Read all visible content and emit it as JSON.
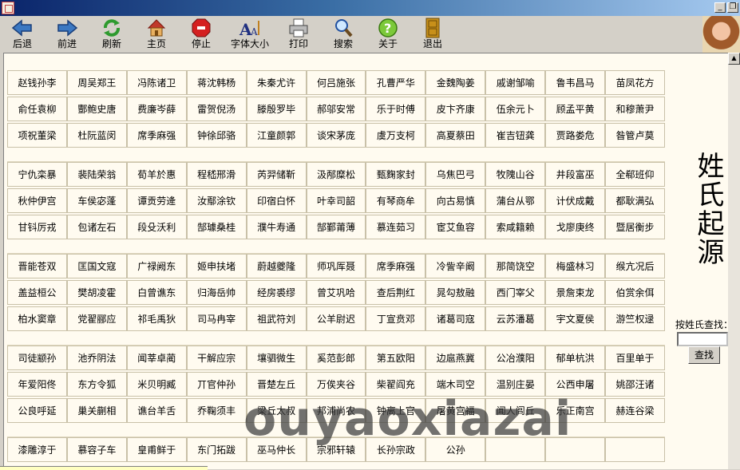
{
  "toolbar": [
    {
      "label": "后退",
      "icon": "back-arrow-icon"
    },
    {
      "label": "前进",
      "icon": "forward-arrow-icon"
    },
    {
      "label": "刷新",
      "icon": "refresh-icon"
    },
    {
      "label": "主页",
      "icon": "home-icon"
    },
    {
      "label": "停止",
      "icon": "stop-icon"
    },
    {
      "label": "字体大小",
      "icon": "font-size-icon"
    },
    {
      "label": "打印",
      "icon": "print-icon"
    },
    {
      "label": "搜索",
      "icon": "search-icon"
    },
    {
      "label": "关于",
      "icon": "help-icon"
    },
    {
      "label": "退出",
      "icon": "exit-door-icon"
    }
  ],
  "side_title": "姓氏起源",
  "search": {
    "label": "按姓氏查找：",
    "button": "查找"
  },
  "watermark": "ouyaoxiazai",
  "groups": [
    [
      [
        "赵钱孙李",
        "周吴郑王",
        "冯陈诸卫",
        "蒋沈韩杨",
        "朱秦尤许",
        "何吕施张",
        "孔曹严华",
        "金魏陶姜",
        "戚谢邹喻",
        "鲁韦昌马",
        "苗凤花方"
      ],
      [
        "俞任袁柳",
        "酆鲍史唐",
        "费廉岑薛",
        "雷贺倪汤",
        "滕殷罗毕",
        "郝邬安常",
        "乐于时傅",
        "皮卞齐康",
        "伍余元卜",
        "顾孟平黄",
        "和穆萧尹"
      ],
      [
        "项祝董梁",
        "杜阮蓝闵",
        "席季麻强",
        "钟徐邱骆",
        "江童颜郭",
        "谈宋茅庞",
        "虞万支柯",
        "高夏蔡田",
        "崔吉钮龚",
        "贾路娄危",
        "昝管卢莫"
      ]
    ],
    [
      [
        "宁仇栾暴",
        "裴陆荣翁",
        "荀羊於惠",
        "程嵇邢滑",
        "芮羿储靳",
        "汲邴糜松",
        "甄麴家封",
        "乌焦巴弓",
        "牧隗山谷",
        "井段富巫",
        "全郗班仰"
      ],
      [
        "秋仲伊宫",
        "车侯宓蓬",
        "谭贡劳逄",
        "汝鄢涂钦",
        "印宿白怀",
        "叶幸司韶",
        "有琴商牟",
        "向古易慎",
        "蒲台从鄂",
        "计伏成戴",
        "都耿满弘"
      ],
      [
        "甘钭厉戎",
        "包诸左石",
        "段殳沃利",
        "郜璩桑桂",
        "濮牛寿通",
        "郜鄞莆薄",
        "慕连茹习",
        "宦艾鱼容",
        "索咸籍赖",
        "戈廖庚终",
        "暨居衡步"
      ]
    ],
    [
      [
        "晋能苍双",
        "匡国文寇",
        "广禄阙东",
        "姬申扶堵",
        "蔚越夔隆",
        "师巩厍聂",
        "席季麻强",
        "冷訾辛阚",
        "那简饶空",
        "梅盛林习",
        "缑亢况后"
      ],
      [
        "盖益桓公",
        "樊胡凌霍",
        "白曾谯东",
        "归海岳帅",
        "经房裘缪",
        "曾艾巩哈",
        "查后荆红",
        "晁勾敖融",
        "西门宰父",
        "景詹束龙",
        "伯赏余佴"
      ],
      [
        "柏水窦章",
        "党翟郦应",
        "祁毛禹狄",
        "司马冉宰",
        "祖武符刘",
        "公羊尉迟",
        "丁宣贲邓",
        "诸葛司寇",
        "云苏潘葛",
        "宇文夏侯",
        "游竺权逯"
      ]
    ],
    [
      [
        "司徒颛孙",
        "池乔阴法",
        "闻莘卓蔺",
        "干解应宗",
        "壤驷微生",
        "奚范彭郎",
        "第五欧阳",
        "边扈燕冀",
        "公冶濮阳",
        "郁单杭洪",
        "百里单于"
      ],
      [
        "年爱阳佟",
        "东方令狐",
        "米贝明臧",
        "丌官仲孙",
        "晋楚左丘",
        "万俟夹谷",
        "柴翟阎充",
        "端木司空",
        "温别庄晏",
        "公西申屠",
        "姚邵汪诸"
      ],
      [
        "公良呼延",
        "巢关蒯相",
        "谯台羊舌",
        "乔鞠须丰",
        "梁丘太叔",
        "邦浦尚农",
        "钟离上官",
        "屠黄宫福",
        "闻人闾丘",
        "乐正南宫",
        "赫连谷梁"
      ]
    ],
    [
      [
        "漆雕淳于",
        "慕容子车",
        "皇甫鲜于",
        "东门拓跋",
        "巫马仲长",
        "宗邪轩辕",
        "长孙宗政",
        "公孙",
        "",
        "",
        ""
      ]
    ]
  ]
}
